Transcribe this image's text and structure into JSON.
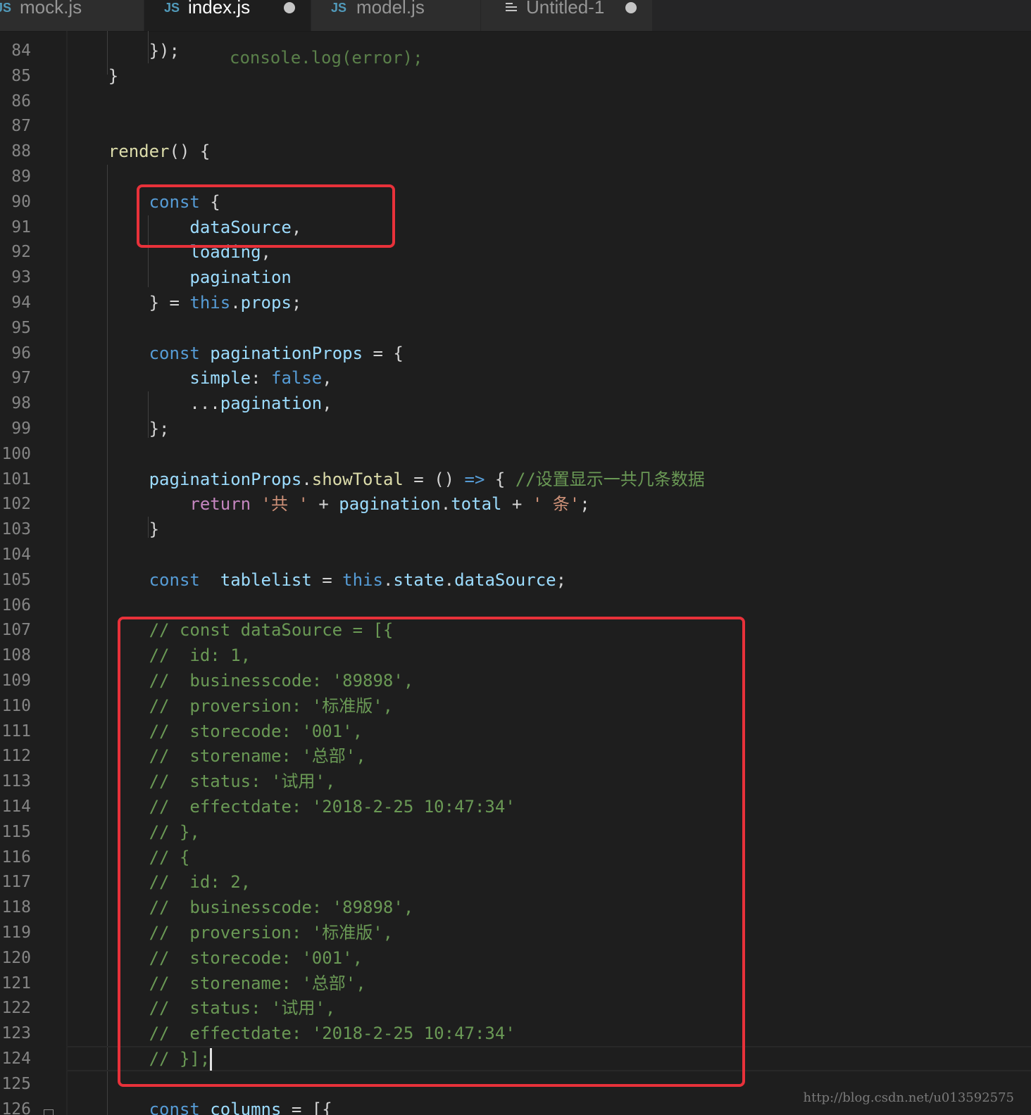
{
  "tabs": [
    {
      "icon": "JS",
      "label": "mock.js",
      "dirty": false,
      "active": false
    },
    {
      "icon": "JS",
      "label": "index.js",
      "dirty": true,
      "active": true
    },
    {
      "icon": "JS",
      "label": "model.js",
      "dirty": false,
      "active": false
    },
    {
      "icon": "file-lines",
      "label": "Untitled-1",
      "dirty": true,
      "active": false
    }
  ],
  "editor": {
    "partial_top_line": "console.log(error);",
    "lines": [
      {
        "n": "84",
        "tokens": [
          [
            "pn",
            "        });"
          ]
        ]
      },
      {
        "n": "85",
        "tokens": [
          [
            "pn",
            "    }"
          ]
        ]
      },
      {
        "n": "86",
        "tokens": []
      },
      {
        "n": "87",
        "tokens": []
      },
      {
        "n": "88",
        "tokens": [
          [
            "fn",
            "    render"
          ],
          [
            "pn",
            "() {"
          ]
        ]
      },
      {
        "n": "89",
        "tokens": []
      },
      {
        "n": "90",
        "tokens": [
          [
            "kw",
            "        const"
          ],
          [
            "pn",
            " {"
          ]
        ]
      },
      {
        "n": "91",
        "tokens": [
          [
            "var",
            "            dataSource"
          ],
          [
            "pn",
            ","
          ]
        ]
      },
      {
        "n": "92",
        "tokens": [
          [
            "var",
            "            loading"
          ],
          [
            "pn",
            ","
          ]
        ]
      },
      {
        "n": "93",
        "tokens": [
          [
            "var",
            "            pagination"
          ]
        ]
      },
      {
        "n": "94",
        "tokens": [
          [
            "pn",
            "        } = "
          ],
          [
            "kw",
            "this"
          ],
          [
            "pn",
            "."
          ],
          [
            "var",
            "props"
          ],
          [
            "pn",
            ";"
          ]
        ]
      },
      {
        "n": "95",
        "tokens": []
      },
      {
        "n": "96",
        "tokens": [
          [
            "kw",
            "        const"
          ],
          [
            "pn",
            " "
          ],
          [
            "var",
            "paginationProps"
          ],
          [
            "pn",
            " = {"
          ]
        ]
      },
      {
        "n": "97",
        "tokens": [
          [
            "var",
            "            simple"
          ],
          [
            "pn",
            ": "
          ],
          [
            "kw",
            "false"
          ],
          [
            "pn",
            ","
          ]
        ]
      },
      {
        "n": "98",
        "tokens": [
          [
            "pn",
            "            ..."
          ],
          [
            "var",
            "pagination"
          ],
          [
            "pn",
            ","
          ]
        ]
      },
      {
        "n": "99",
        "tokens": [
          [
            "pn",
            "        };"
          ]
        ]
      },
      {
        "n": "100",
        "tokens": []
      },
      {
        "n": "101",
        "tokens": [
          [
            "var",
            "        paginationProps"
          ],
          [
            "pn",
            "."
          ],
          [
            "fn",
            "showTotal"
          ],
          [
            "pn",
            " = () "
          ],
          [
            "kw",
            "=>"
          ],
          [
            "pn",
            " { "
          ],
          [
            "cm",
            "//设置显示一共几条数据"
          ]
        ]
      },
      {
        "n": "102",
        "tokens": [
          [
            "ctl",
            "            return"
          ],
          [
            "pn",
            " "
          ],
          [
            "str",
            "'共 '"
          ],
          [
            "pn",
            " + "
          ],
          [
            "var",
            "pagination"
          ],
          [
            "pn",
            "."
          ],
          [
            "var",
            "total"
          ],
          [
            "pn",
            " + "
          ],
          [
            "str",
            "' 条'"
          ],
          [
            "pn",
            ";"
          ]
        ]
      },
      {
        "n": "103",
        "tokens": [
          [
            "pn",
            "        }"
          ]
        ]
      },
      {
        "n": "104",
        "tokens": []
      },
      {
        "n": "105",
        "tokens": [
          [
            "kw",
            "        const"
          ],
          [
            "pn",
            "  "
          ],
          [
            "var",
            "tablelist"
          ],
          [
            "pn",
            " = "
          ],
          [
            "kw",
            "this"
          ],
          [
            "pn",
            "."
          ],
          [
            "var",
            "state"
          ],
          [
            "pn",
            "."
          ],
          [
            "var",
            "dataSource"
          ],
          [
            "pn",
            ";"
          ]
        ]
      },
      {
        "n": "106",
        "tokens": []
      },
      {
        "n": "107",
        "tokens": [
          [
            "cm",
            "        // const dataSource = [{"
          ]
        ]
      },
      {
        "n": "108",
        "tokens": [
          [
            "cm",
            "        //  id: 1,"
          ]
        ]
      },
      {
        "n": "109",
        "tokens": [
          [
            "cm",
            "        //  businesscode: '89898',"
          ]
        ]
      },
      {
        "n": "110",
        "tokens": [
          [
            "cm",
            "        //  proversion: '标准版',"
          ]
        ]
      },
      {
        "n": "111",
        "tokens": [
          [
            "cm",
            "        //  storecode: '001',"
          ]
        ]
      },
      {
        "n": "112",
        "tokens": [
          [
            "cm",
            "        //  storename: '总部',"
          ]
        ]
      },
      {
        "n": "113",
        "tokens": [
          [
            "cm",
            "        //  status: '试用',"
          ]
        ]
      },
      {
        "n": "114",
        "tokens": [
          [
            "cm",
            "        //  effectdate: '2018-2-25 10:47:34'"
          ]
        ]
      },
      {
        "n": "115",
        "tokens": [
          [
            "cm",
            "        // },"
          ]
        ]
      },
      {
        "n": "116",
        "tokens": [
          [
            "cm",
            "        // {"
          ]
        ]
      },
      {
        "n": "117",
        "tokens": [
          [
            "cm",
            "        //  id: 2,"
          ]
        ]
      },
      {
        "n": "118",
        "tokens": [
          [
            "cm",
            "        //  businesscode: '89898',"
          ]
        ]
      },
      {
        "n": "119",
        "tokens": [
          [
            "cm",
            "        //  proversion: '标准版',"
          ]
        ]
      },
      {
        "n": "120",
        "tokens": [
          [
            "cm",
            "        //  storecode: '001',"
          ]
        ]
      },
      {
        "n": "121",
        "tokens": [
          [
            "cm",
            "        //  storename: '总部',"
          ]
        ]
      },
      {
        "n": "122",
        "tokens": [
          [
            "cm",
            "        //  status: '试用',"
          ]
        ]
      },
      {
        "n": "123",
        "tokens": [
          [
            "cm",
            "        //  effectdate: '2018-2-25 10:47:34'"
          ]
        ]
      },
      {
        "n": "124",
        "tokens": [
          [
            "cm",
            "        // }];"
          ]
        ],
        "cursor": true,
        "current": true
      },
      {
        "n": "125",
        "tokens": []
      },
      {
        "n": "126",
        "tokens": [
          [
            "kw",
            "        const"
          ],
          [
            "pn",
            " "
          ],
          [
            "var",
            "columns"
          ],
          [
            "pn",
            " = [{"
          ]
        ],
        "fold": true
      }
    ]
  },
  "watermark": "http://blog.csdn.net/u013592575",
  "colors": {
    "background": "#1e1e1e",
    "keyword": "#569cd6",
    "variable": "#9cdcfe",
    "function": "#dcdcaa",
    "string": "#ce9178",
    "comment": "#6a9955",
    "control": "#c586c0",
    "highlight_box": "#e8313a"
  }
}
